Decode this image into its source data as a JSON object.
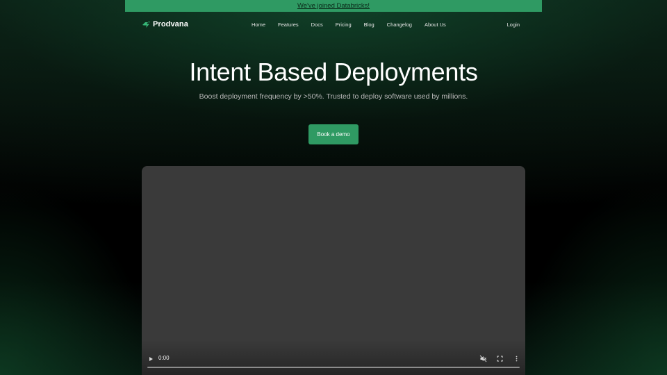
{
  "announcement": {
    "text": "We've joined Databricks!",
    "color": "#2f9a63"
  },
  "nav": {
    "logo_text": "Prodvana",
    "logo_icon": "prodvana-logo-icon",
    "links": [
      {
        "label": "Home"
      },
      {
        "label": "Features"
      },
      {
        "label": "Docs"
      },
      {
        "label": "Pricing"
      },
      {
        "label": "Blog"
      },
      {
        "label": "Changelog"
      },
      {
        "label": "About Us"
      }
    ],
    "login_label": "Login"
  },
  "hero": {
    "title": "Intent Based Deployments",
    "subtitle": "Boost deployment frequency by >50%. Trusted to deploy software used by millions.",
    "cta_label": "Book a demo",
    "accent_color": "#2f9a63"
  },
  "video_player": {
    "current_time": "0:00",
    "progress": 0,
    "muted": true,
    "icons": [
      "play-icon",
      "muted-volume-icon",
      "fullscreen-icon",
      "more-options-icon"
    ]
  }
}
